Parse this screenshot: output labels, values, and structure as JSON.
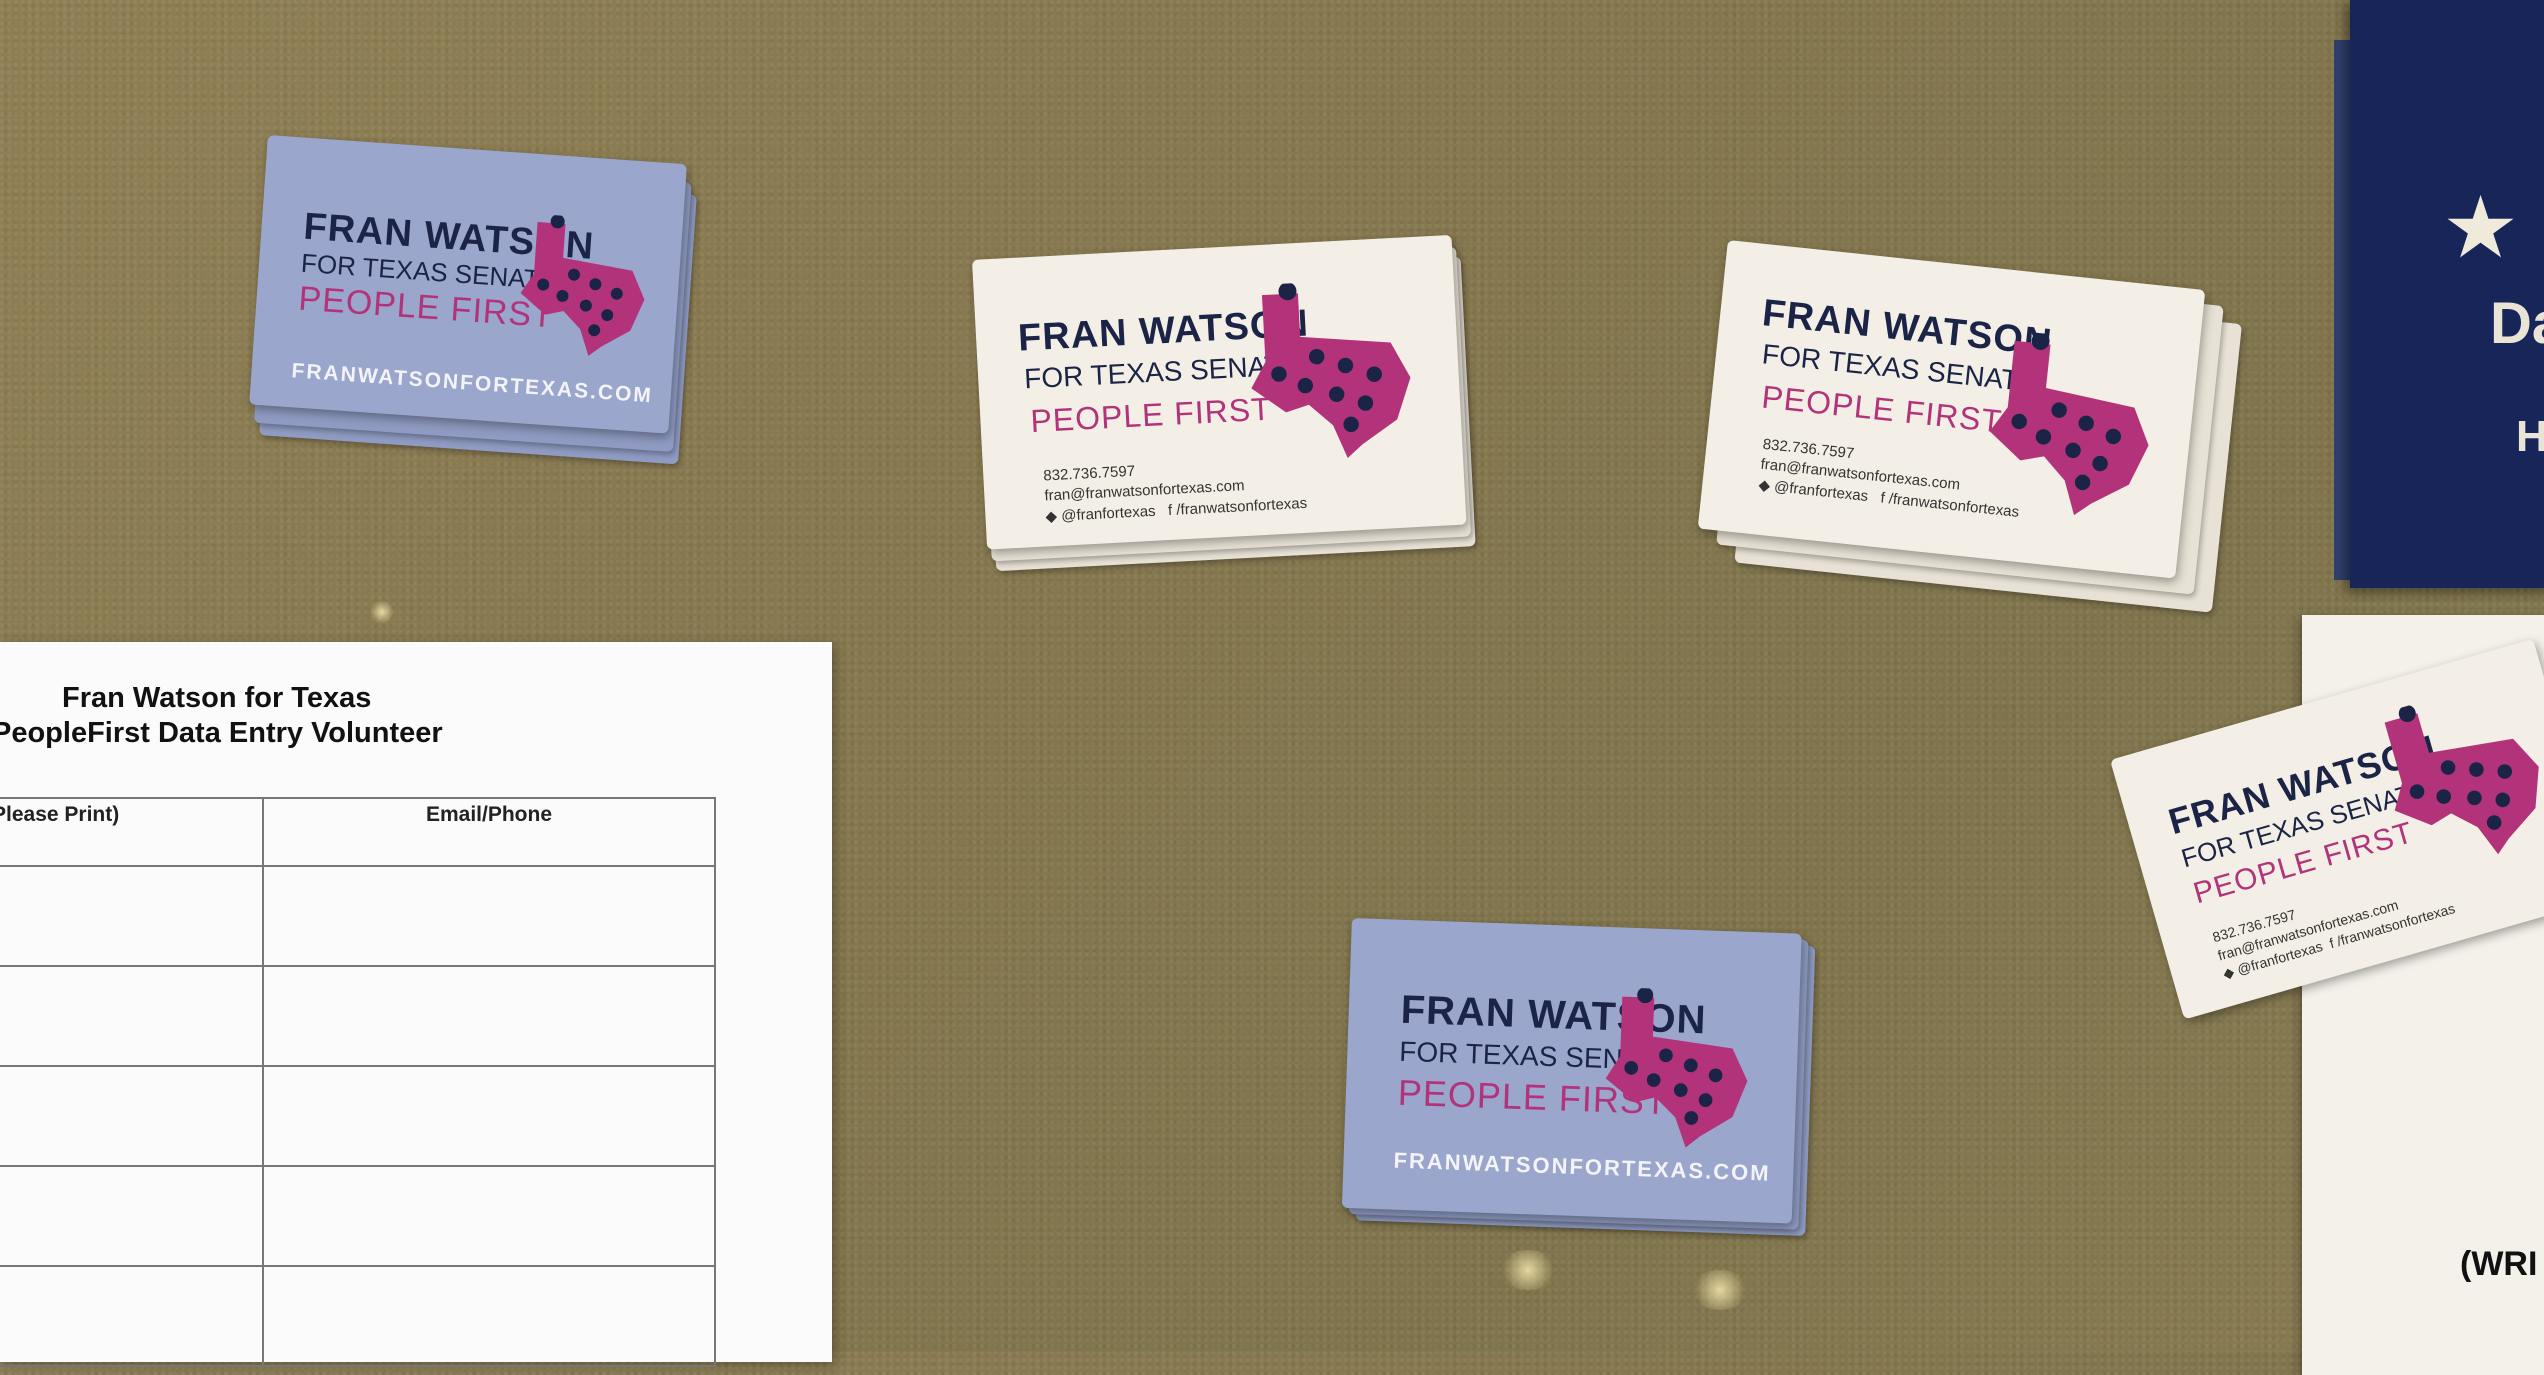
{
  "cards": {
    "name": "FRAN WATSON",
    "office": "FOR TEXAS SENATE",
    "slogan": "PEOPLE FIRST",
    "website": "FRANWATSONFORTEXAS.COM",
    "phone": "832.736.7597",
    "email": "fran@franwatsonfortexas.com",
    "twitter": "@franfortexas",
    "facebook": "/franwatsonfortexas"
  },
  "signup_sheet": {
    "title_line1": "Fran Watson for Texas",
    "title_line2": "PeopleFirst Data Entry Volunteer",
    "columns": [
      "Please Print)",
      "Email/Phone"
    ]
  },
  "flyer": {
    "partial_text": "(WRI"
  },
  "poster": {
    "partial_letters": "Da",
    "partial_letters_2": "H"
  },
  "colors": {
    "table": "#86784f",
    "card_lavender": "#9aa6cc",
    "card_white": "#f3efe6",
    "navy": "#1b2446",
    "magenta": "#b2337a"
  }
}
